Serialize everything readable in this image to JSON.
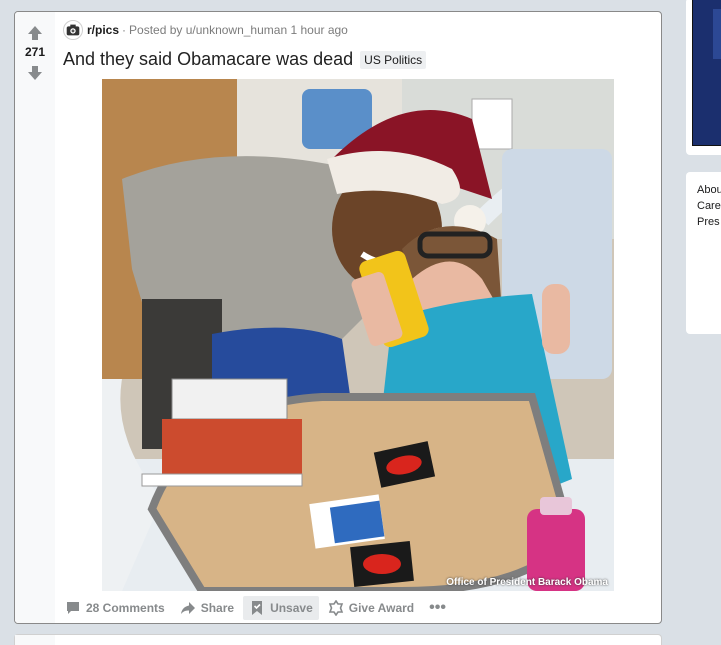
{
  "post": {
    "score": "271",
    "subreddit": "r/pics",
    "separator": "·",
    "posted_by": "Posted by u/unknown_human 1 hour ago",
    "title": "And they said Obamacare was dead",
    "flair": "US Politics",
    "image_watermark": "Office of President Barack Obama"
  },
  "actions": {
    "comments": "28 Comments",
    "share": "Share",
    "unsave": "Unsave",
    "give_award": "Give Award",
    "more": "•••"
  },
  "sidebar": {
    "lines": [
      "Abou",
      "Care",
      "Pres"
    ]
  },
  "icons": {
    "upvote": "arrow-up-icon",
    "downvote": "arrow-down-icon",
    "comments": "comment-icon",
    "share": "share-arrow-icon",
    "unsave": "bookmark-icon",
    "award": "award-icon"
  },
  "colors": {
    "page_bg": "#dae0e6",
    "vote_arrow": "#878a8c",
    "text_primary": "#1a1a1b",
    "flair_bg": "#edeff1"
  }
}
